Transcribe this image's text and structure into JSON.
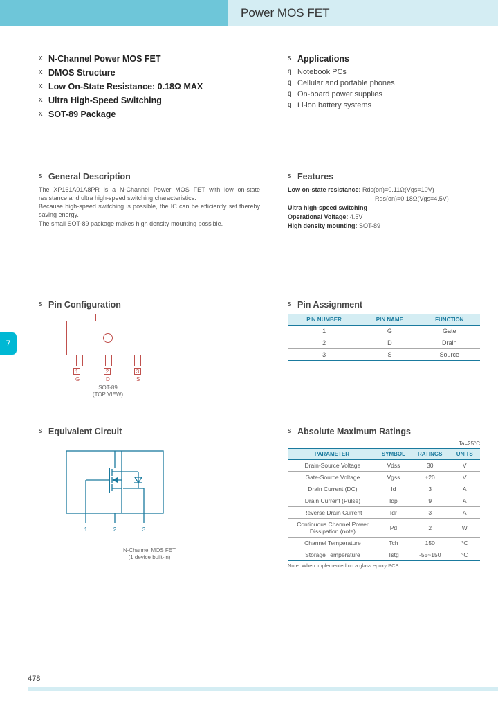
{
  "header": {
    "title": "Power MOS FET"
  },
  "main_features": [
    "N-Channel Power MOS FET",
    "DMOS Structure",
    "Low On-State Resistance: 0.18Ω MAX",
    "Ultra High-Speed Switching",
    "SOT-89 Package"
  ],
  "applications": {
    "heading": "Applications",
    "items": [
      "Notebook PCs",
      "Cellular and portable phones",
      "On-board power supplies",
      "Li-ion battery systems"
    ]
  },
  "general": {
    "heading": "General Description",
    "text": "The XP161A01A8PR is a N-Channel Power MOS FET with low on-state resistance and ultra high-speed switching characteristics.\nBecause high-speed switching is possible, the IC can be efficiently set thereby saving energy.\nThe small SOT-89 package makes high density mounting possible."
  },
  "features": {
    "heading": "Features",
    "lines": {
      "l1a": "Low on-state resistance:",
      "l1b": "Rds(on)=0.11Ω(Vgs=10V)",
      "l1c": "Rds(on)=0.18Ω(Vgs=4.5V)",
      "l2": "Ultra high-speed switching",
      "l3a": "Operational Voltage:",
      "l3b": "4.5V",
      "l4a": "High density mounting:",
      "l4b": "SOT-89"
    }
  },
  "pin_config": {
    "heading": "Pin Configuration",
    "label_line1": "SOT-89",
    "label_line2": "(TOP VIEW)",
    "pins": {
      "n1": "1",
      "n2": "2",
      "n3": "3",
      "l1": "G",
      "l2": "D",
      "l3": "S"
    }
  },
  "pin_assign": {
    "heading": "Pin Assignment",
    "cols": [
      "PIN NUMBER",
      "PIN NAME",
      "FUNCTION"
    ],
    "rows": [
      {
        "num": "1",
        "name": "G",
        "func": "Gate"
      },
      {
        "num": "2",
        "name": "D",
        "func": "Drain"
      },
      {
        "num": "3",
        "name": "S",
        "func": "Source"
      }
    ]
  },
  "eqcirc": {
    "heading": "Equivalent Circuit",
    "label_line1": "N-Channel MOS FET",
    "label_line2": "(1 device built-in)",
    "pins": {
      "p1": "1",
      "p2": "2",
      "p3": "3"
    }
  },
  "ratings": {
    "heading": "Absolute Maximum Ratings",
    "temp": "Ta=25°C",
    "cols": [
      "PARAMETER",
      "SYMBOL",
      "RATINGS",
      "UNITS"
    ],
    "rows": [
      {
        "param": "Drain-Source Voltage",
        "sym": "Vdss",
        "rating": "30",
        "unit": "V"
      },
      {
        "param": "Gate-Source Voltage",
        "sym": "Vgss",
        "rating": "±20",
        "unit": "V"
      },
      {
        "param": "Drain Current (DC)",
        "sym": "Id",
        "rating": "3",
        "unit": "A"
      },
      {
        "param": "Drain Current (Pulse)",
        "sym": "Idp",
        "rating": "9",
        "unit": "A"
      },
      {
        "param": "Reverse Drain Current",
        "sym": "Idr",
        "rating": "3",
        "unit": "A"
      },
      {
        "param": "Continuous Channel Power Dissipation (note)",
        "sym": "Pd",
        "rating": "2",
        "unit": "W"
      },
      {
        "param": "Channel Temperature",
        "sym": "Tch",
        "rating": "150",
        "unit": "°C"
      },
      {
        "param": "Storage Temperature",
        "sym": "Tstg",
        "rating": "-55~150",
        "unit": "°C"
      }
    ],
    "note": "Note: When implemented on a glass epoxy PCB"
  },
  "page_tab": "7",
  "page_num": "478"
}
